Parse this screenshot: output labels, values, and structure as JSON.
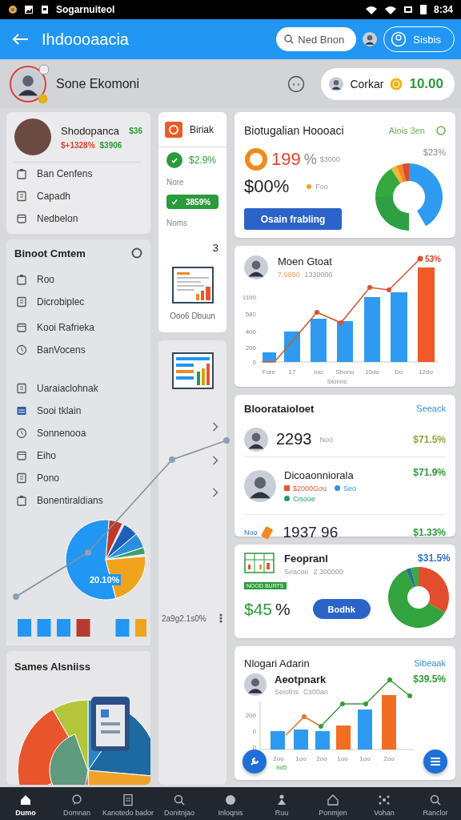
{
  "status_bar": {
    "app_name": "Sogarnuiteol",
    "time": "8:34"
  },
  "header": {
    "title": "Ihdoooaacia",
    "search": {
      "placeholder": "Ned Bnon"
    },
    "action": "Sisbis"
  },
  "profile": {
    "name": "Sone Ekomoni",
    "account": "Corkar",
    "balance": "10.00"
  },
  "summary_card": {
    "name": "Shodopanca",
    "amount": "$36",
    "change": "$+1328%",
    "secondary": "$3906",
    "items": [
      "Ban Cenfens",
      "Capadh",
      "Nedbelon"
    ]
  },
  "menu_panel": {
    "title": "Binoot Cmtem",
    "groups": [
      [
        "Roo",
        "Dicrobiplec"
      ],
      [
        "Kooi Rafrieka",
        "BanVocens"
      ],
      [
        "Uaraiaclohnak",
        "Sooi tklain",
        "Sonnenooa",
        "Eiho",
        "Pono",
        "Bonentiraldians"
      ]
    ],
    "pie_label": "20.10%"
  },
  "sales_card": {
    "title": "Sames Alsniiss"
  },
  "side_card": {
    "title": "Biriak",
    "value": "$2.9%",
    "label_1": "Nore",
    "pill": "3859%",
    "label_2": "Noms",
    "count": "3",
    "caption": "Ooo6 Dbuun"
  },
  "side_panel": {
    "note": "2a9g2.1s0%"
  },
  "overview_card": {
    "title": "Biotugalian Hoooaci",
    "link": "Alois 3en",
    "percent": "199",
    "percent_sign": "%",
    "sub_value": "$3000",
    "total": "$00%",
    "legend_label": "Foo",
    "button": "Osain frabling",
    "donut_label": "$23%"
  },
  "growth_card": {
    "name": "Moen Gtoat",
    "subtitle_1": "7.9890",
    "subtitle_2": "1330000",
    "peak_label": "53%",
    "y_ticks": [
      "1100",
      "580",
      "400",
      "200",
      "0"
    ],
    "x_labels": [
      "Fore",
      "17",
      "Ioo",
      "Sbono",
      "10do",
      "Do",
      "12do"
    ],
    "xlabel": "Stonnc"
  },
  "list_card": {
    "title": "Bloorataioloet",
    "link": "Seeack",
    "rows": [
      {
        "kind": "simple",
        "value": "2293",
        "unit": "Noo",
        "change": "$71.5%"
      },
      {
        "kind": "detailed",
        "name": "Dicoaonniorala",
        "change": "$71.9%",
        "tags": [
          {
            "label": "$2000Gou",
            "color": "#e8552d"
          },
          {
            "label": "Seo",
            "color": "#2f8fe0"
          },
          {
            "label": "Cisooe",
            "color": "#1f9d6a"
          }
        ]
      },
      {
        "kind": "tagged",
        "prefix": "Noo",
        "value": "1937 96",
        "change": "$1.33%"
      }
    ]
  },
  "report_card": {
    "title": "Feopranl",
    "subtitle_1": "Seacoe",
    "subtitle_2": "2 300000",
    "badge": "NOOD BURTS",
    "value": "$45",
    "value_sign": "%",
    "button": "Bodhk",
    "percent": "$31.5%"
  },
  "admin_card": {
    "title": "Nlogari Adarin",
    "link": "Sibeaak",
    "name": "Aeotpnark",
    "subtitle_1": "Seiotns",
    "subtitle_2": "Cs00an",
    "percent": "$39.5%",
    "y_ticks": [
      "200",
      "0",
      "0"
    ],
    "x_labels": [
      "2oo",
      "1oo",
      "2oo",
      "1oo",
      "1oo",
      "2oo"
    ],
    "footnote": "9d5"
  },
  "bottom_nav": [
    {
      "label": "Dumo",
      "selected": true
    },
    {
      "label": "Domnan",
      "selected": false
    },
    {
      "label": "Kanotedo bador",
      "selected": false
    },
    {
      "label": "Donitnjao",
      "selected": false
    },
    {
      "label": "Inloqnis",
      "selected": false
    },
    {
      "label": "Ruu",
      "selected": false
    },
    {
      "label": "Ponmjen",
      "selected": false
    },
    {
      "label": "Vohan",
      "selected": false
    },
    {
      "label": "Ranclor",
      "selected": false
    }
  ]
}
